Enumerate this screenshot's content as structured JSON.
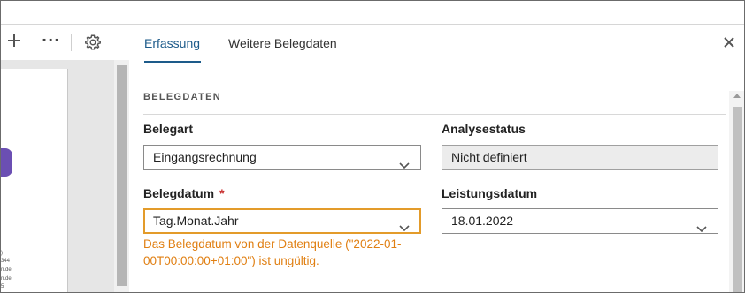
{
  "toolbar": {
    "icons": [
      "plus-icon",
      "more-icon",
      "settings-icon"
    ],
    "more_glyph": "···"
  },
  "document_preview": {
    "logo_color": "#6b4fb3",
    "snippet_lines": [
      ")",
      "344",
      "n.de",
      "",
      "n.de",
      "5"
    ]
  },
  "tabs": [
    {
      "label": "Erfassung",
      "active": true
    },
    {
      "label": "Weitere Belegdaten",
      "active": false
    }
  ],
  "section": {
    "title": "BELEGDATEN"
  },
  "fields": {
    "belegart": {
      "label": "Belegart",
      "value": "Eingangsrechnung"
    },
    "analysestatus": {
      "label": "Analysestatus",
      "value": "Nicht definiert"
    },
    "belegdatum": {
      "label": "Belegdatum",
      "required_marker": "*",
      "value": "Tag.Monat.Jahr",
      "error": "Das Belegdatum von der Datenquelle (\"2022-01-00T00:00:00+01:00\") ist ungültig."
    },
    "leistungsdatum": {
      "label": "Leistungsdatum",
      "value": "18.01.2022"
    }
  },
  "colors": {
    "accent": "#1d5b8a",
    "error": "#e07f12",
    "required": "#c62828"
  }
}
